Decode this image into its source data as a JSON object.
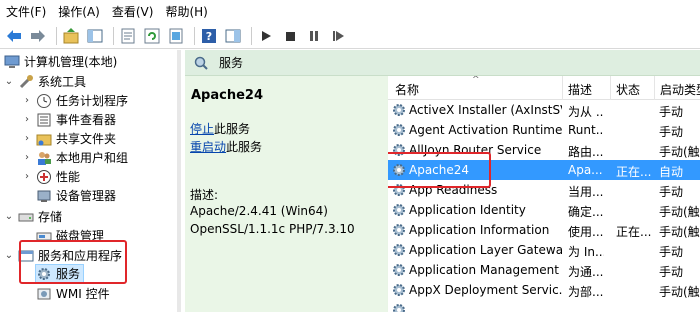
{
  "menu": [
    "文件(F)",
    "操作(A)",
    "查看(V)",
    "帮助(H)"
  ],
  "tree": {
    "root": "计算机管理(本地)",
    "system_tools": "系统工具",
    "task_scheduler": "任务计划程序",
    "event_viewer": "事件查看器",
    "shared_folders": "共享文件夹",
    "local_users": "本地用户和组",
    "performance": "性能",
    "device_manager": "设备管理器",
    "storage": "存储",
    "disk_management": "磁盘管理",
    "services_apps": "服务和应用程序",
    "services": "服务",
    "wmi": "WMI 控件"
  },
  "header": {
    "title": "服务"
  },
  "detail": {
    "service_name": "Apache24",
    "stop_link": "停止",
    "stop_rest": "此服务",
    "restart_link": "重启动",
    "restart_rest": "此服务",
    "desc_label": "描述:",
    "desc_line1": "Apache/2.4.41 (Win64)",
    "desc_line2": "OpenSSL/1.1.1c PHP/7.3.10"
  },
  "columns": [
    "名称",
    "描述",
    "状态",
    "启动类型"
  ],
  "rows": [
    {
      "name": "ActiveX Installer (AxInstSV)",
      "desc": "为从 ...",
      "status": "",
      "start": "手动"
    },
    {
      "name": "Agent Activation Runtime...",
      "desc": "Runt...",
      "status": "",
      "start": "手动"
    },
    {
      "name": "AllJoyn Router Service",
      "desc": "路由...",
      "status": "",
      "start": "手动(触"
    },
    {
      "name": "Apache24",
      "desc": "Apa...",
      "status": "正在...",
      "start": "自动"
    },
    {
      "name": "App Readiness",
      "desc": "当用...",
      "status": "",
      "start": "手动"
    },
    {
      "name": "Application Identity",
      "desc": "确定...",
      "status": "",
      "start": "手动(触"
    },
    {
      "name": "Application Information",
      "desc": "使用...",
      "status": "正在...",
      "start": "手动(触"
    },
    {
      "name": "Application Layer Gatewa...",
      "desc": "为 In...",
      "status": "",
      "start": "手动"
    },
    {
      "name": "Application Management",
      "desc": "为通...",
      "status": "",
      "start": "手动"
    },
    {
      "name": "AppX Deployment Servic...",
      "desc": "为部...",
      "status": "",
      "start": "手动(触"
    },
    {
      "name": "",
      "desc": "",
      "status": "",
      "start": ""
    }
  ]
}
